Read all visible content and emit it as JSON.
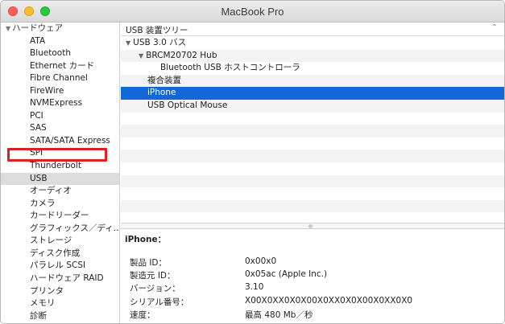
{
  "window": {
    "title": "MacBook Pro"
  },
  "sidebar": {
    "header": "ハードウェア",
    "items": [
      "ATA",
      "Bluetooth",
      "Ethernet カード",
      "Fibre Channel",
      "FireWire",
      "NVMExpress",
      "PCI",
      "SAS",
      "SATA/SATA Express",
      "SPI",
      "Thunderbolt",
      "USB",
      "オーディオ",
      "カメラ",
      "カードリーダー",
      "グラフィックス／ディ...",
      "ストレージ",
      "ディスク作成",
      "パラレル SCSI",
      "ハードウェア RAID",
      "プリンタ",
      "メモリ",
      "診断"
    ],
    "selected": "USB"
  },
  "tree": {
    "header": "USB 装置ツリー",
    "rows": [
      {
        "label": "USB 3.0 バス",
        "level": 0,
        "expanded": true
      },
      {
        "label": "BRCM20702 Hub",
        "level": 1,
        "expanded": true
      },
      {
        "label": "Bluetooth USB ホストコントローラ",
        "level": 2
      },
      {
        "label": "複合装置",
        "level": 1
      },
      {
        "label": "iPhone",
        "level": 1,
        "selected": true
      },
      {
        "label": "USB Optical Mouse",
        "level": 1
      }
    ]
  },
  "detail": {
    "title": "iPhone：",
    "rows": [
      {
        "key": "製品 ID：",
        "value": "0x00x0"
      },
      {
        "key": "製造元 ID：",
        "value": "0x05ac  (Apple Inc.)"
      },
      {
        "key": "バージョン：",
        "value": "3.10"
      },
      {
        "key": "シリアル番号：",
        "value": "X00X0XX0X0X00X0XX0X0X00X0XX0X0"
      },
      {
        "key": "速度：",
        "value": "最高 480 Mb／秒"
      }
    ]
  },
  "colors": {
    "selection": "#1467d8",
    "highlight_box": "#e02020",
    "sidebar_selected": "#dcdcdc"
  }
}
